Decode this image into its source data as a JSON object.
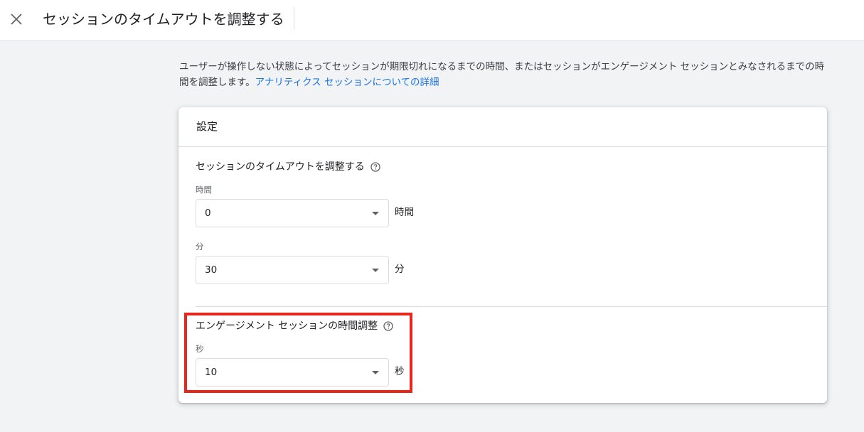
{
  "header": {
    "title": "セッションのタイムアウトを調整する",
    "close_icon": "close-icon"
  },
  "description": {
    "text": "ユーザーが操作しない状態によってセッションが期限切れになるまでの時間、またはセッションがエンゲージメント セッションとみなされるまでの時間を調整します。",
    "link": "アナリティクス セッションについての詳細"
  },
  "card": {
    "title": "設定",
    "timeout_section": {
      "title": "セッションのタイムアウトを調整する",
      "help_icon": "help-circle-icon",
      "hours": {
        "label": "時間",
        "value": "0",
        "unit": "時間"
      },
      "minutes": {
        "label": "分",
        "value": "30",
        "unit": "分"
      }
    },
    "engagement_section": {
      "title": "エンゲージメント セッションの時間調整",
      "help_icon": "help-circle-icon",
      "seconds": {
        "label": "秒",
        "value": "10",
        "unit": "秒"
      }
    }
  },
  "colors": {
    "link": "#1a73e8",
    "highlight": "#e8261c",
    "background": "#f1f3f4"
  }
}
